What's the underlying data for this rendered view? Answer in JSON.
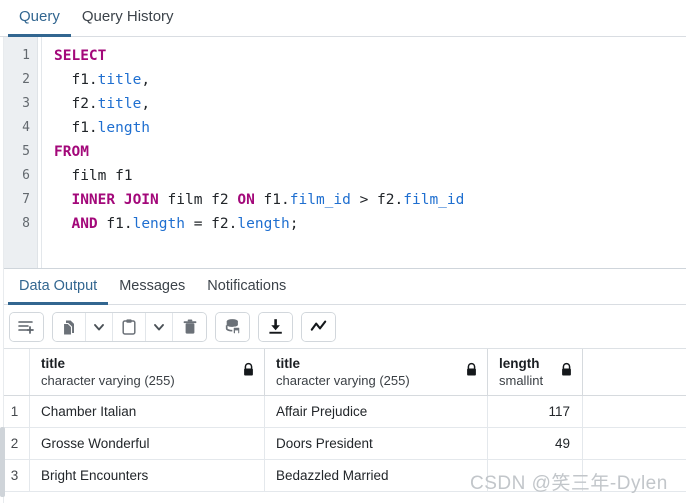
{
  "query_tabs": [
    {
      "label": "Query",
      "active": true
    },
    {
      "label": "Query History",
      "active": false
    }
  ],
  "editor": {
    "line_numbers": [
      "1",
      "2",
      "3",
      "4",
      "5",
      "6",
      "7",
      "8"
    ],
    "lines": [
      {
        "n": "1",
        "tokens": [
          {
            "t": "SELECT",
            "c": "kw"
          }
        ]
      },
      {
        "n": "2",
        "tokens": [
          {
            "t": "  f1.",
            "c": "plain"
          },
          {
            "t": "title",
            "c": "ident"
          },
          {
            "t": ",",
            "c": "punc"
          }
        ]
      },
      {
        "n": "3",
        "tokens": [
          {
            "t": "  f2.",
            "c": "plain"
          },
          {
            "t": "title",
            "c": "ident"
          },
          {
            "t": ",",
            "c": "punc"
          }
        ]
      },
      {
        "n": "4",
        "tokens": [
          {
            "t": "  f1.",
            "c": "plain"
          },
          {
            "t": "length",
            "c": "ident"
          }
        ]
      },
      {
        "n": "5",
        "tokens": [
          {
            "t": "FROM",
            "c": "kw"
          }
        ]
      },
      {
        "n": "6",
        "tokens": [
          {
            "t": "  film f1",
            "c": "plain"
          }
        ]
      },
      {
        "n": "7",
        "tokens": [
          {
            "t": "  ",
            "c": "plain"
          },
          {
            "t": "INNER JOIN",
            "c": "kw"
          },
          {
            "t": " film f2 ",
            "c": "plain"
          },
          {
            "t": "ON",
            "c": "kw"
          },
          {
            "t": " f1.",
            "c": "plain"
          },
          {
            "t": "film_id",
            "c": "ident"
          },
          {
            "t": " > f2.",
            "c": "plain"
          },
          {
            "t": "film_id",
            "c": "ident"
          }
        ]
      },
      {
        "n": "8",
        "tokens": [
          {
            "t": "  ",
            "c": "plain"
          },
          {
            "t": "AND",
            "c": "kw"
          },
          {
            "t": " f1.",
            "c": "plain"
          },
          {
            "t": "length",
            "c": "ident"
          },
          {
            "t": " = f2.",
            "c": "plain"
          },
          {
            "t": "length",
            "c": "ident"
          },
          {
            "t": ";",
            "c": "punc"
          }
        ]
      }
    ],
    "full_sql": "SELECT\n  f1.title,\n  f2.title,\n  f1.length\nFROM\n  film f1\n  INNER JOIN film f2 ON f1.film_id > f2.film_id\n  AND f1.length = f2.length;"
  },
  "result_tabs": [
    {
      "label": "Data Output",
      "active": true
    },
    {
      "label": "Messages",
      "active": false
    },
    {
      "label": "Notifications",
      "active": false
    }
  ],
  "toolbar": {
    "groups": [
      {
        "buttons": [
          {
            "icon": "add-row-icon"
          }
        ]
      },
      {
        "buttons": [
          {
            "icon": "copy-icon"
          },
          {
            "icon": "chevron-down-icon"
          },
          {
            "icon": "paste-icon"
          },
          {
            "icon": "chevron-down-icon"
          },
          {
            "icon": "delete-icon"
          }
        ]
      },
      {
        "buttons": [
          {
            "icon": "save-data-changes-icon"
          }
        ]
      },
      {
        "buttons": [
          {
            "icon": "download-icon"
          }
        ]
      },
      {
        "buttons": [
          {
            "icon": "graph-visualiser-icon"
          }
        ]
      }
    ]
  },
  "grid": {
    "columns": [
      {
        "name": "title",
        "type": "character varying (255)",
        "locked": true
      },
      {
        "name": "title",
        "type": "character varying (255)",
        "locked": true
      },
      {
        "name": "length",
        "type": "smallint",
        "locked": true
      }
    ],
    "rows": [
      {
        "num": "1",
        "title1": "Chamber Italian",
        "title2": "Affair Prejudice",
        "length": "117"
      },
      {
        "num": "2",
        "title1": "Grosse Wonderful",
        "title2": "Doors President",
        "length": "49"
      },
      {
        "num": "3",
        "title1": "Bright Encounters",
        "title2": "Bedazzled Married",
        "length": ""
      }
    ]
  },
  "watermark": {
    "text": "CSDN @笑三年-Dylen"
  },
  "colors": {
    "accent": "#326690",
    "keyword": "#a3087a",
    "identifier": "#1f6fd0",
    "gutter_bg": "#eceff2",
    "border": "#e4e8ec"
  }
}
